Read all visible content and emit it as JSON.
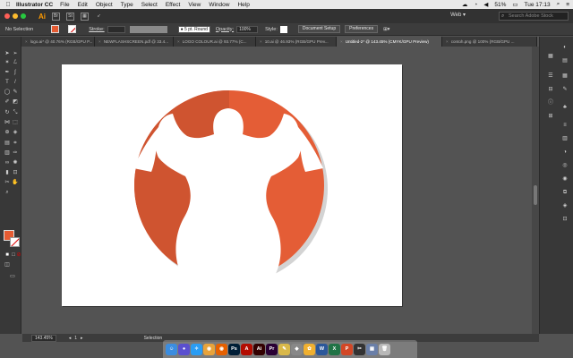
{
  "menubar": {
    "apple": "",
    "app_name": "Illustrator CC",
    "items": [
      "File",
      "Edit",
      "Object",
      "Type",
      "Select",
      "Effect",
      "View",
      "Window",
      "Help"
    ],
    "battery": "51%",
    "time": "Tue 17:13"
  },
  "appbar": {
    "logo": "Ai",
    "workspace": "Web",
    "search_placeholder": "Search Adobe Stock"
  },
  "controlbar": {
    "selection_label": "No Selection",
    "stroke_label": "Stroke:",
    "brush": "5 pt. Round",
    "opacity_label": "Opacity:",
    "opacity_value": "100%",
    "style_label": "Style:",
    "document_setup": "Document Setup",
    "preferences": "Preferences"
  },
  "tabs": [
    {
      "label": "logo.ai* @ 40.76% (RGB/GPU P...",
      "active": false
    },
    {
      "label": "NEWFLASHSCREEN.pdf @ 33.4...",
      "active": false
    },
    {
      "label": "LOGO COLOUR.ai @ 93.77% (C...",
      "active": false
    },
    {
      "label": "10.ai @ 46.93% (RGB/GPU Prev...",
      "active": false
    },
    {
      "label": "Untitled-2* @ 143.45% (CMYK/GPU Preview)",
      "active": true
    },
    {
      "label": "contoh.png @ 100% (RGB/GPU ...",
      "active": false
    }
  ],
  "artwork": {
    "circle_light": "#e45d36",
    "circle_dark": "#cf5430",
    "shadow": "#d3d3d3"
  },
  "statusbar": {
    "zoom": "143.45%",
    "page": "1",
    "tool": "Selection"
  },
  "dock_icons": [
    {
      "name": "finder-icon",
      "color": "#3b8de0",
      "glyph": "☺"
    },
    {
      "name": "siri-icon",
      "color": "#5a4fcf",
      "glyph": "●"
    },
    {
      "name": "safari-icon",
      "color": "#2a9df4",
      "glyph": "✧"
    },
    {
      "name": "chrome-icon",
      "color": "#e8a33b",
      "glyph": "◉"
    },
    {
      "name": "firefox-icon",
      "color": "#e66000",
      "glyph": "◉"
    },
    {
      "name": "photoshop-icon",
      "color": "#001e36",
      "glyph": "Ps"
    },
    {
      "name": "acrobat-icon",
      "color": "#b30b00",
      "glyph": "A"
    },
    {
      "name": "illustrator-icon",
      "color": "#330000",
      "glyph": "Ai"
    },
    {
      "name": "premiere-icon",
      "color": "#2a0034",
      "glyph": "Pr"
    },
    {
      "name": "notes-icon",
      "color": "#d9b84a",
      "glyph": "✎"
    },
    {
      "name": "keynote-icon",
      "color": "#888888",
      "glyph": "◆"
    },
    {
      "name": "photos-icon",
      "color": "#f0b030",
      "glyph": "✿"
    },
    {
      "name": "word-icon",
      "color": "#2b579a",
      "glyph": "W"
    },
    {
      "name": "excel-icon",
      "color": "#217346",
      "glyph": "X"
    },
    {
      "name": "powerpoint-icon",
      "color": "#d24726",
      "glyph": "P"
    },
    {
      "name": "finalcut-icon",
      "color": "#333333",
      "glyph": "✂"
    },
    {
      "name": "preview-icon",
      "color": "#6a7fa8",
      "glyph": "▦"
    },
    {
      "name": "trash-icon",
      "color": "#b8b8b8",
      "glyph": "🗑"
    }
  ]
}
